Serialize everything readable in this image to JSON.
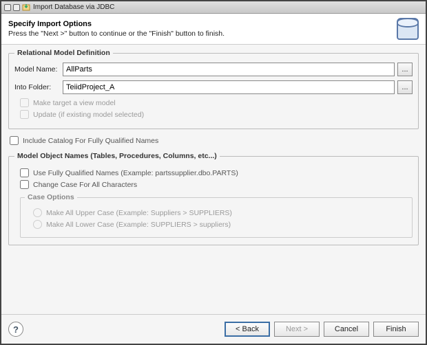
{
  "window": {
    "title": "Import Database via JDBC"
  },
  "header": {
    "title": "Specify Import Options",
    "subtitle": "Press the \"Next >\" button to continue or the \"Finish\" button to finish."
  },
  "relational": {
    "legend": "Relational Model Definition",
    "modelNameLabel": "Model Name:",
    "modelNameValue": "AllParts",
    "intoFolderLabel": "Into Folder:",
    "intoFolderValue": "TeiidProject_A",
    "browseLabel": "...",
    "makeViewLabel": "Make target a view model",
    "updateLabel": "Update (if existing model selected)"
  },
  "includeCatalogLabel": "Include Catalog For Fully Qualified Names",
  "objectNames": {
    "legend": "Model Object Names (Tables, Procedures, Columns, etc...)",
    "useFqnLabel": "Use Fully Qualified Names  (Example: partssupplier.dbo.PARTS)",
    "changeCaseLabel": "Change Case For All Characters",
    "caseOptionsLegend": "Case Options",
    "upperLabel": "Make All Upper Case  (Example: Suppliers > SUPPLIERS)",
    "lowerLabel": "Make All Lower Case  (Example: SUPPLIERS > suppliers)"
  },
  "footer": {
    "help": "?",
    "back": "< Back",
    "next": "Next >",
    "cancel": "Cancel",
    "finish": "Finish"
  }
}
